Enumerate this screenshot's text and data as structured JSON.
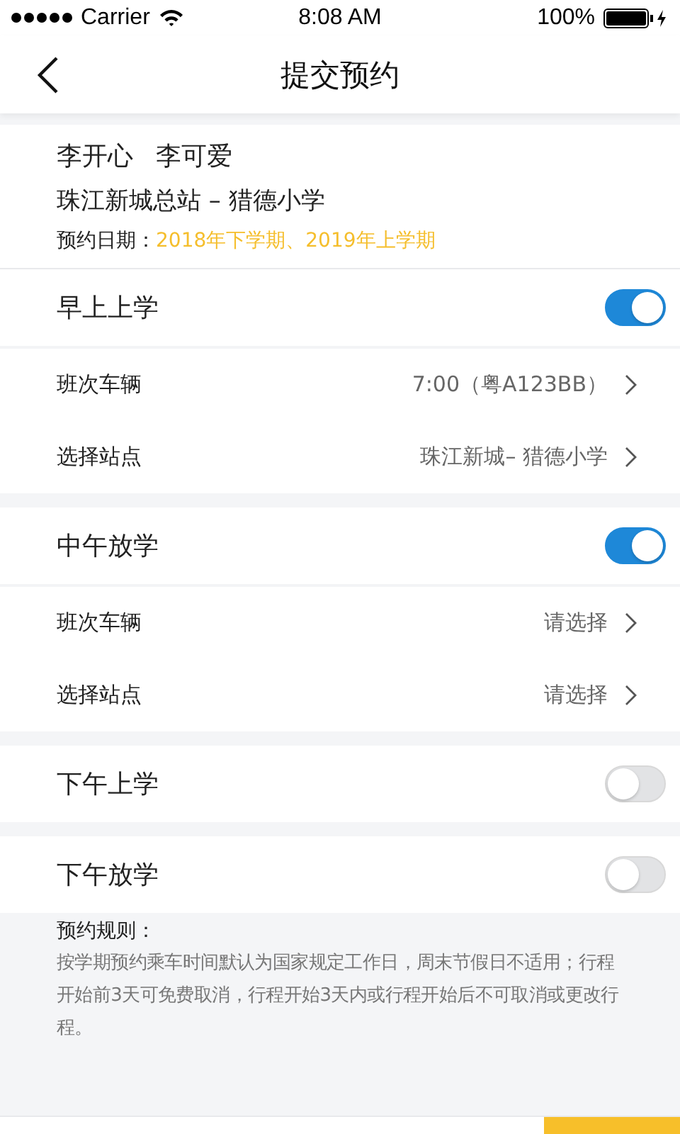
{
  "status_bar": {
    "carrier": "Carrier",
    "time": "8:08 AM",
    "battery": "100%"
  },
  "nav": {
    "title": "提交预约"
  },
  "summary": {
    "names": [
      "李开心",
      "李可爱"
    ],
    "route": "珠江新城总站 – 猎德小学",
    "date_label": "预约日期：",
    "date_value": "2018年下学期、2019年上学期"
  },
  "sections": [
    {
      "title": "早上上学",
      "on": true,
      "rows": [
        {
          "label": "班次车辆",
          "value": "7:00（粤A123BB）"
        },
        {
          "label": "选择站点",
          "value": "珠江新城– 猎德小学"
        }
      ]
    },
    {
      "title": "中午放学",
      "on": true,
      "rows": [
        {
          "label": "班次车辆",
          "value": "请选择"
        },
        {
          "label": "选择站点",
          "value": "请选择"
        }
      ]
    },
    {
      "title": "下午上学",
      "on": false
    },
    {
      "title": "下午放学",
      "on": false
    }
  ],
  "rules": {
    "title": "预约规则：",
    "text": "按学期预约乘车时间默认为国家规定工作日，周末节假日不适用；行程开始前3天可免费取消，行程开始3天内或行程开始后不可取消或更改行程。"
  }
}
